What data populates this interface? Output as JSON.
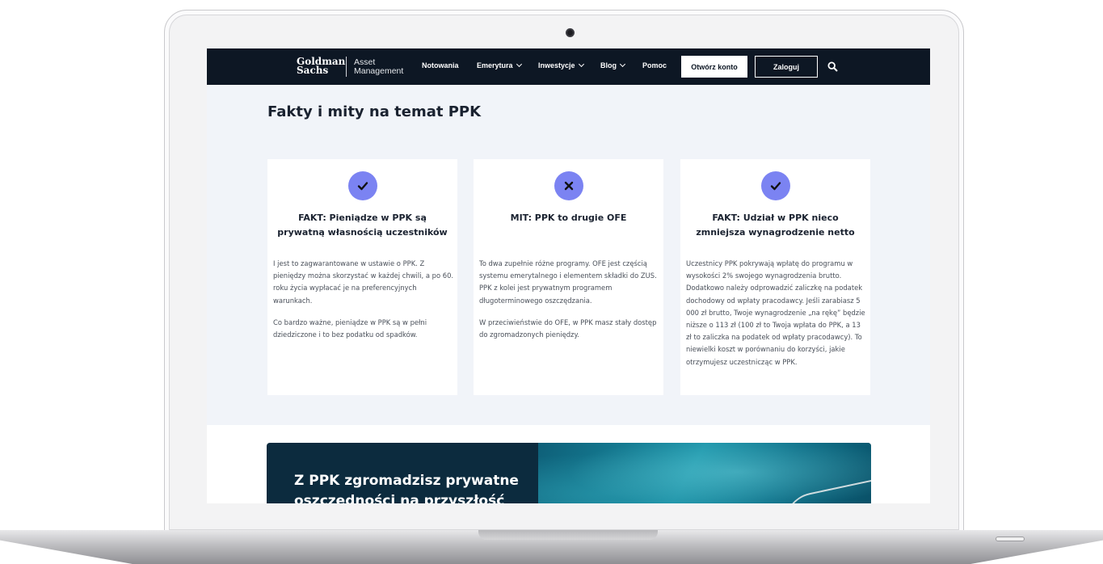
{
  "nav": {
    "logo_line1": "Goldman",
    "logo_line2": "Sachs",
    "logo_am_line1": "Asset",
    "logo_am_line2": "Management",
    "items": [
      {
        "label": "Notowania"
      },
      {
        "label": "Emerytura"
      },
      {
        "label": "Inwestycje"
      },
      {
        "label": "Blog"
      },
      {
        "label": "Pomoc"
      }
    ],
    "open_account": "Otwórz konto",
    "login": "Zaloguj"
  },
  "page": {
    "title": "Fakty i mity na temat PPK"
  },
  "cards": [
    {
      "icon": "check-icon",
      "title": "FAKT: Pieniądze w PPK są prywatną własnością uczestników",
      "paragraphs": [
        "I jest to zagwarantowane w ustawie o PPK. Z pieniędzy można skorzystać w każdej chwili, a po 60. roku życia wypłacać je na preferencyjnych warunkach.",
        "Co bardzo ważne, pieniądze w PPK są w pełni dziedziczone i to bez podatku od spadków."
      ]
    },
    {
      "icon": "x-icon",
      "title": "MIT: PPK to drugie OFE",
      "paragraphs": [
        "To dwa zupełnie różne programy. OFE jest częścią systemu emerytalnego i elementem składki do ZUS. PPK z kolei jest prywatnym programem długoterminowego oszczędzania.",
        "W przeciwieństwie do OFE, w PPK masz stały dostęp do zgromadzonych pieniędzy."
      ]
    },
    {
      "icon": "check-icon",
      "title": "FAKT: Udział w PPK nieco zmniejsza wynagrodzenie netto",
      "paragraphs": [
        "Uczestnicy PPK pokrywają wpłatę do programu w wysokości 2% swojego wynagrodzenia brutto. Dodatkowo należy odprowadzić zaliczkę na podatek dochodowy od wpłaty pracodawcy. Jeśli zarabiasz 5 000 zł brutto, Twoje wynagrodzenie „na rękę” będzie niższe o 113 zł (100 zł to Twoja wpłata do PPK, a 13 zł to zaliczka na podatek od wpłaty pracodawcy). To niewielki koszt w porównaniu do korzyści, jakie otrzymujesz uczestnicząc w PPK."
      ]
    }
  ],
  "banner": {
    "text": "Z PPK zgromadzisz prywatne oszczędności na przyszłość"
  },
  "colors": {
    "navbar": "#0d1724",
    "accent_icon": "#7b83f2",
    "page_bg": "#f1f4f9"
  }
}
